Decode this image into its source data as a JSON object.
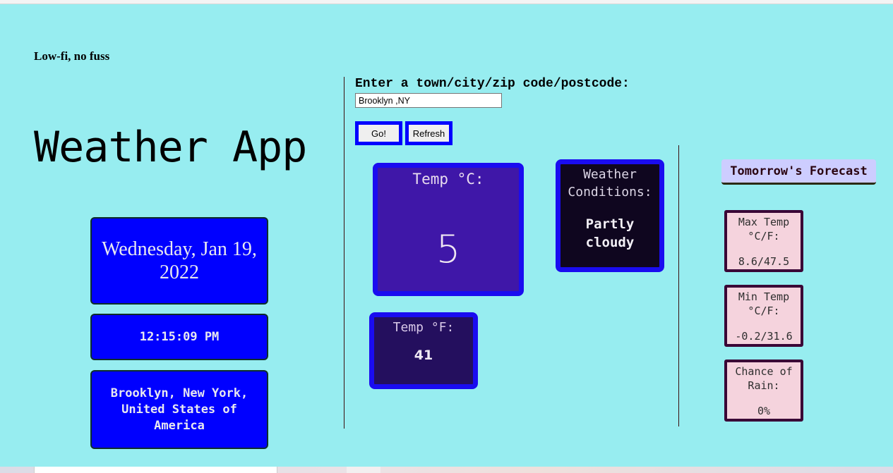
{
  "header": {
    "tagline": "Low-fi, no fuss",
    "app_title": "Weather App"
  },
  "info": {
    "date": "Wednesday, Jan 19, 2022",
    "time": "12:15:09 PM",
    "location": "Brooklyn, New York, United States of America"
  },
  "search": {
    "label": "Enter a town/city/zip code/postcode:",
    "value": "Brooklyn ,NY",
    "go_label": "Go!",
    "refresh_label": "Refresh"
  },
  "current": {
    "temp_c_label": "Temp °C:",
    "temp_c_value": "5",
    "temp_f_label": "Temp °F:",
    "temp_f_value": "41",
    "conditions_label": "Weather Conditions:",
    "conditions_value": "Partly cloudy"
  },
  "forecast": {
    "title": "Tomorrow's Forecast",
    "items": [
      {
        "label": "Max Temp °C/F:",
        "value": "8.6/47.5"
      },
      {
        "label": "Min Temp °C/F:",
        "value": "-0.2/31.6"
      },
      {
        "label": "Chance of Rain:",
        "value": "0%"
      }
    ]
  },
  "colors": {
    "background": "#97edf0",
    "info_box": "#0000ff",
    "card_border": "#1a0cf0",
    "temp_c_bg": "#3f17a8",
    "temp_f_bg": "#240f5e",
    "conditions_bg": "#0f061f",
    "forecast_title_bg": "#cdcdff",
    "forecast_card_bg": "#f5d3dd",
    "forecast_card_border": "#3a0536"
  }
}
